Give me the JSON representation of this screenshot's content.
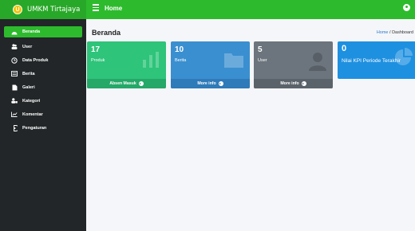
{
  "brand": {
    "name": "UMKM Tirtajaya",
    "logo_glyph": "U"
  },
  "topbar": {
    "title": "Home"
  },
  "sidebar": {
    "items": [
      {
        "label": "Beranda",
        "icon": "dashboard-icon",
        "active": true
      },
      {
        "label": "User",
        "icon": "users-icon"
      },
      {
        "label": "Data Produk",
        "icon": "clock-icon"
      },
      {
        "label": "Berita",
        "icon": "newspaper-icon"
      },
      {
        "label": "Galeri",
        "icon": "file-image-icon"
      },
      {
        "label": "Kategori",
        "icon": "user-tag-icon"
      },
      {
        "label": "Komentar",
        "icon": "chart-line-icon"
      },
      {
        "label": "Pengaturan",
        "icon": "settings-icon"
      }
    ]
  },
  "main": {
    "title": "Beranda",
    "breadcrumb": {
      "home": "Home",
      "separator": " / ",
      "current": "Dashboard"
    },
    "cards": [
      {
        "value": "17",
        "label": "Produk",
        "footer": "Absen Masuk",
        "icon": "bar-chart-icon",
        "color": "#2ec47a"
      },
      {
        "value": "10",
        "label": "Berita",
        "footer": "More info",
        "icon": "folder-icon",
        "color": "#3a8fd0"
      },
      {
        "value": "5",
        "label": "User",
        "footer": "More info",
        "icon": "user-icon",
        "color": "#6c757d"
      },
      {
        "value": "0",
        "label": "Nilai KPI Periode Terakhir",
        "icon": "pie-chart-icon",
        "color": "#1e90e0"
      }
    ]
  },
  "colors": {
    "accent": "#2dbb2d",
    "sidebar_bg": "#222628"
  }
}
